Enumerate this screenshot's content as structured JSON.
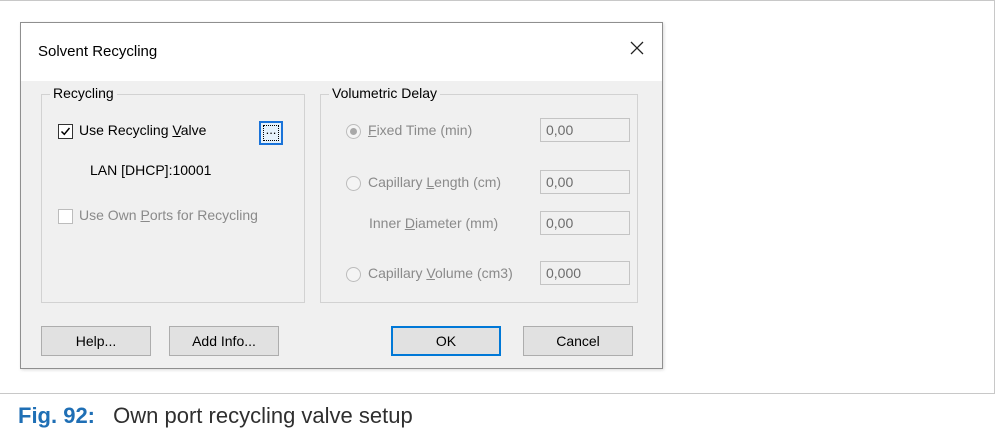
{
  "dialog": {
    "title": "Solvent Recycling",
    "recycling": {
      "group_label": "Recycling",
      "use_valve": {
        "label": "Use Recycling Valve",
        "checked": true
      },
      "ellipsis_label": "...",
      "valve_address": "LAN [DHCP]:10001",
      "own_ports": {
        "label": "Use Own Ports for Recycling",
        "checked": false,
        "disabled": true
      }
    },
    "volumetric_delay": {
      "group_label": "Volumetric Delay",
      "fixed_time": {
        "label": "Fixed Time (min)",
        "value": "0,00",
        "selected": true
      },
      "capillary_length": {
        "label": "Capillary Length (cm)",
        "value": "0,00",
        "selected": false
      },
      "inner_diameter": {
        "label": "Inner Diameter (mm)",
        "value": "0,00"
      },
      "capillary_volume": {
        "label": "Capillary Volume (cm3)",
        "value": "0,000",
        "selected": false
      }
    },
    "buttons": {
      "help": "Help...",
      "add_info": "Add Info...",
      "ok": "OK",
      "cancel": "Cancel"
    }
  },
  "caption": {
    "number": "Fig. 92:",
    "text": "Own port recycling valve setup"
  },
  "colors": {
    "caption_number": "#1f6fb5",
    "focus_border": "#1a73d9",
    "dialog_bg": "#f0f0f0"
  }
}
